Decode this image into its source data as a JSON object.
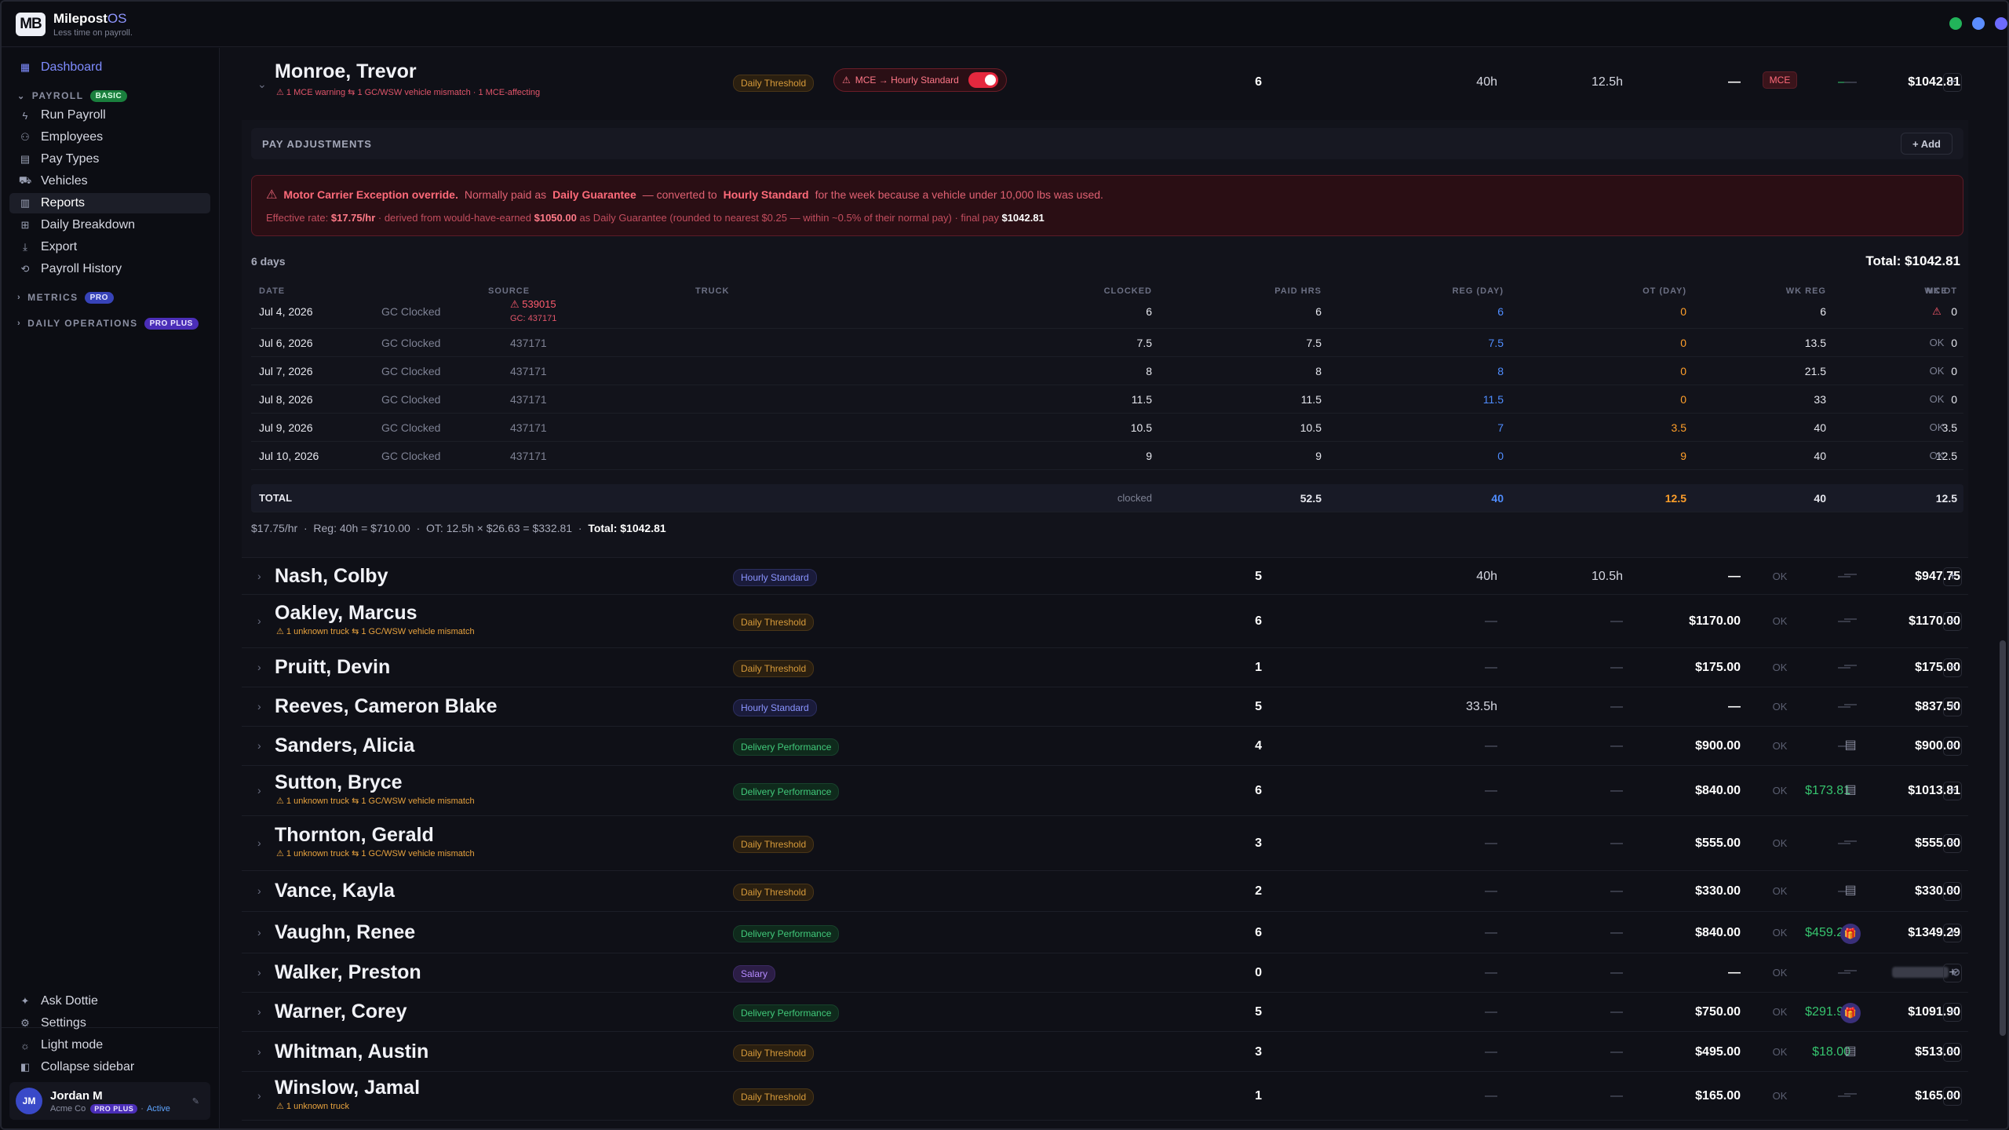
{
  "app": {
    "logo": "MB",
    "name": "Milepost",
    "name_accent": "OS",
    "tagline": "Less time on payroll."
  },
  "colors": {
    "accent": "#7f8cff",
    "danger": "#e5283e",
    "ok_green": "#36c46e",
    "warn_orange": "#ff9f2a"
  },
  "sidebar": {
    "dashboard": "Dashboard",
    "payroll_section": "PAYROLL",
    "payroll_badge": "BASIC",
    "items": [
      "Run Payroll",
      "Employees",
      "Pay Types",
      "Vehicles",
      "Reports",
      "Daily Breakdown",
      "Export",
      "Payroll History"
    ],
    "metrics_section": "METRICS",
    "metrics_badge": "PRO",
    "daily_ops_section": "DAILY OPERATIONS",
    "daily_ops_badge": "PRO PLUS",
    "bottom": [
      "Ask Dottie",
      "Settings",
      "Light mode",
      "Collapse sidebar"
    ],
    "user": {
      "initials": "JM",
      "name": "Jordan M",
      "company": "Acme Co",
      "plan": "PRO PLUS",
      "status": "Active"
    }
  },
  "expanded_employee": {
    "name": "Monroe, Trevor",
    "warnings": "1 MCE warning  ⇆ 1 GC/WSW vehicle mismatch · 1 MCE-affecting",
    "pay_type": "Daily Threshold",
    "mce_toggle_label": "MCE → Hourly Standard",
    "days": "6",
    "reg": "40h",
    "ot": "12.5h",
    "base": "—",
    "bonus": "—",
    "mce": "MCE",
    "icon": "—",
    "total": "$1042.81",
    "adjustments_label": "PAY ADJUSTMENTS",
    "add_label": "+ Add",
    "alert": {
      "title": "Motor Carrier Exception override.",
      "t1": "Normally paid as",
      "b1": "Daily Guarantee",
      "t2": "— converted to",
      "b2": "Hourly Standard",
      "t3": "for the week because a vehicle under 10,000 lbs was used.",
      "l2a": "Effective rate:",
      "rate": "$17.75/hr",
      "l2b": "· derived from would-have-earned",
      "would": "$1050.00",
      "l2c": "as Daily Guarantee (rounded to nearest $0.25 — within ~0.5% of their normal pay) · final pay",
      "final": "$1042.81"
    },
    "days_label": "6 days",
    "grand_total": "Total: $1042.81",
    "table_headers": [
      "DATE",
      "SOURCE",
      "TRUCK",
      "CLOCKED",
      "PAID HRS",
      "REG (DAY)",
      "OT (DAY)",
      "WK REG",
      "WK OT",
      "MCE"
    ],
    "table_rows": [
      {
        "date": "Jul 4, 2026",
        "source": "GC Clocked",
        "truck": "539015",
        "truck_gc": "GC: 437171",
        "clocked": "6",
        "paid": "6",
        "reg": "6",
        "ot": "0",
        "wkreg": "6",
        "wkot": "0",
        "mce": "⚠"
      },
      {
        "date": "Jul 6, 2026",
        "source": "GC Clocked",
        "truck": "437171",
        "truck_gc": "",
        "clocked": "7.5",
        "paid": "7.5",
        "reg": "7.5",
        "ot": "0",
        "wkreg": "13.5",
        "wkot": "0",
        "mce": "OK"
      },
      {
        "date": "Jul 7, 2026",
        "source": "GC Clocked",
        "truck": "437171",
        "truck_gc": "",
        "clocked": "8",
        "paid": "8",
        "reg": "8",
        "ot": "0",
        "wkreg": "21.5",
        "wkot": "0",
        "mce": "OK"
      },
      {
        "date": "Jul 8, 2026",
        "source": "GC Clocked",
        "truck": "437171",
        "truck_gc": "",
        "clocked": "11.5",
        "paid": "11.5",
        "reg": "11.5",
        "ot": "0",
        "wkreg": "33",
        "wkot": "0",
        "mce": "OK"
      },
      {
        "date": "Jul 9, 2026",
        "source": "GC Clocked",
        "truck": "437171",
        "truck_gc": "",
        "clocked": "10.5",
        "paid": "10.5",
        "reg": "7",
        "ot": "3.5",
        "wkreg": "40",
        "wkot": "3.5",
        "mce": "OK"
      },
      {
        "date": "Jul 10, 2026",
        "source": "GC Clocked",
        "truck": "437171",
        "truck_gc": "",
        "clocked": "9",
        "paid": "9",
        "reg": "0",
        "ot": "9",
        "wkreg": "40",
        "wkot": "12.5",
        "mce": "OK"
      }
    ],
    "total_row": {
      "label": "TOTAL",
      "clocked": "clocked",
      "paid": "52.5",
      "reg": "40",
      "ot": "12.5",
      "wkreg": "40",
      "wkot": "12.5"
    },
    "formula": {
      "a": "$17.75/hr",
      "b": "Reg: 40h = $710.00",
      "c": "OT: 12.5h × $26.63 = $332.81",
      "total": "Total: $1042.81"
    }
  },
  "employees": [
    {
      "name": "Nash, Colby",
      "warn": "",
      "type": "Hourly Standard",
      "cls": "b-hourly",
      "days": "5",
      "reg": "40h",
      "ot": "10.5h",
      "base": "—",
      "bonus": "—",
      "mce": "OK",
      "icon": "—",
      "total": "$947.75"
    },
    {
      "name": "Oakley, Marcus",
      "warn": "⚠ 1 unknown truck  ⇆ 1 GC/WSW vehicle mismatch",
      "type": "Daily Threshold",
      "cls": "b-daily",
      "days": "6",
      "reg": "—",
      "ot": "—",
      "base": "$1170.00",
      "bonus": "—",
      "mce": "OK",
      "icon": "—",
      "total": "$1170.00"
    },
    {
      "name": "Pruitt, Devin",
      "warn": "",
      "type": "Daily Threshold",
      "cls": "b-daily",
      "days": "1",
      "reg": "—",
      "ot": "—",
      "base": "$175.00",
      "bonus": "—",
      "mce": "OK",
      "icon": "—",
      "total": "$175.00"
    },
    {
      "name": "Reeves, Cameron Blake",
      "warn": "",
      "type": "Hourly Standard",
      "cls": "b-hourly",
      "days": "5",
      "reg": "33.5h",
      "ot": "—",
      "base": "—",
      "bonus": "—",
      "mce": "OK",
      "icon": "—",
      "total": "$837.50"
    },
    {
      "name": "Sanders, Alicia",
      "warn": "",
      "type": "Delivery Performance",
      "cls": "b-deliv",
      "days": "4",
      "reg": "—",
      "ot": "—",
      "base": "$900.00",
      "bonus": "—",
      "mce": "OK",
      "icon": "▤",
      "total": "$900.00"
    },
    {
      "name": "Sutton, Bryce",
      "warn": "⚠ 1 unknown truck  ⇆ 1 GC/WSW vehicle mismatch",
      "type": "Delivery Performance",
      "cls": "b-deliv",
      "days": "6",
      "reg": "—",
      "ot": "—",
      "base": "$840.00",
      "bonus": "$173.81",
      "mce": "OK",
      "icon": "▤",
      "total": "$1013.81"
    },
    {
      "name": "Thornton, Gerald",
      "warn": "⚠ 1 unknown truck  ⇆ 1 GC/WSW vehicle mismatch",
      "type": "Daily Threshold",
      "cls": "b-daily",
      "days": "3",
      "reg": "—",
      "ot": "—",
      "base": "$555.00",
      "bonus": "—",
      "mce": "OK",
      "icon": "—",
      "total": "$555.00"
    },
    {
      "name": "Vance, Kayla",
      "warn": "",
      "type": "Daily Threshold",
      "cls": "b-daily",
      "days": "2",
      "reg": "—",
      "ot": "—",
      "base": "$330.00",
      "bonus": "—",
      "mce": "OK",
      "icon": "▤",
      "total": "$330.00"
    },
    {
      "name": "Vaughn, Renee",
      "warn": "",
      "type": "Delivery Performance",
      "cls": "b-deliv",
      "days": "6",
      "reg": "—",
      "ot": "—",
      "base": "$840.00",
      "bonus": "$459.29",
      "mce": "OK",
      "icon": "🎁",
      "total": "$1349.29"
    },
    {
      "name": "Walker, Preston",
      "warn": "",
      "type": "Salary",
      "cls": "b-salary",
      "days": "0",
      "reg": "—",
      "ot": "—",
      "base": "—",
      "bonus": "—",
      "mce": "OK",
      "icon": "—",
      "total": ""
    },
    {
      "name": "Warner, Corey",
      "warn": "",
      "type": "Delivery Performance",
      "cls": "b-deliv",
      "days": "5",
      "reg": "—",
      "ot": "—",
      "base": "$750.00",
      "bonus": "$291.90",
      "mce": "OK",
      "icon": "🎁",
      "total": "$1091.90"
    },
    {
      "name": "Whitman, Austin",
      "warn": "",
      "type": "Daily Threshold",
      "cls": "b-daily",
      "days": "3",
      "reg": "—",
      "ot": "—",
      "base": "$495.00",
      "bonus": "$18.00",
      "mce": "OK",
      "icon": "▤",
      "total": "$513.00"
    },
    {
      "name": "Winslow, Jamal",
      "warn": "⚠ 1 unknown truck",
      "type": "Daily Threshold",
      "cls": "b-daily",
      "days": "1",
      "reg": "—",
      "ot": "—",
      "base": "$165.00",
      "bonus": "—",
      "mce": "OK",
      "icon": "—",
      "total": "$165.00"
    }
  ]
}
